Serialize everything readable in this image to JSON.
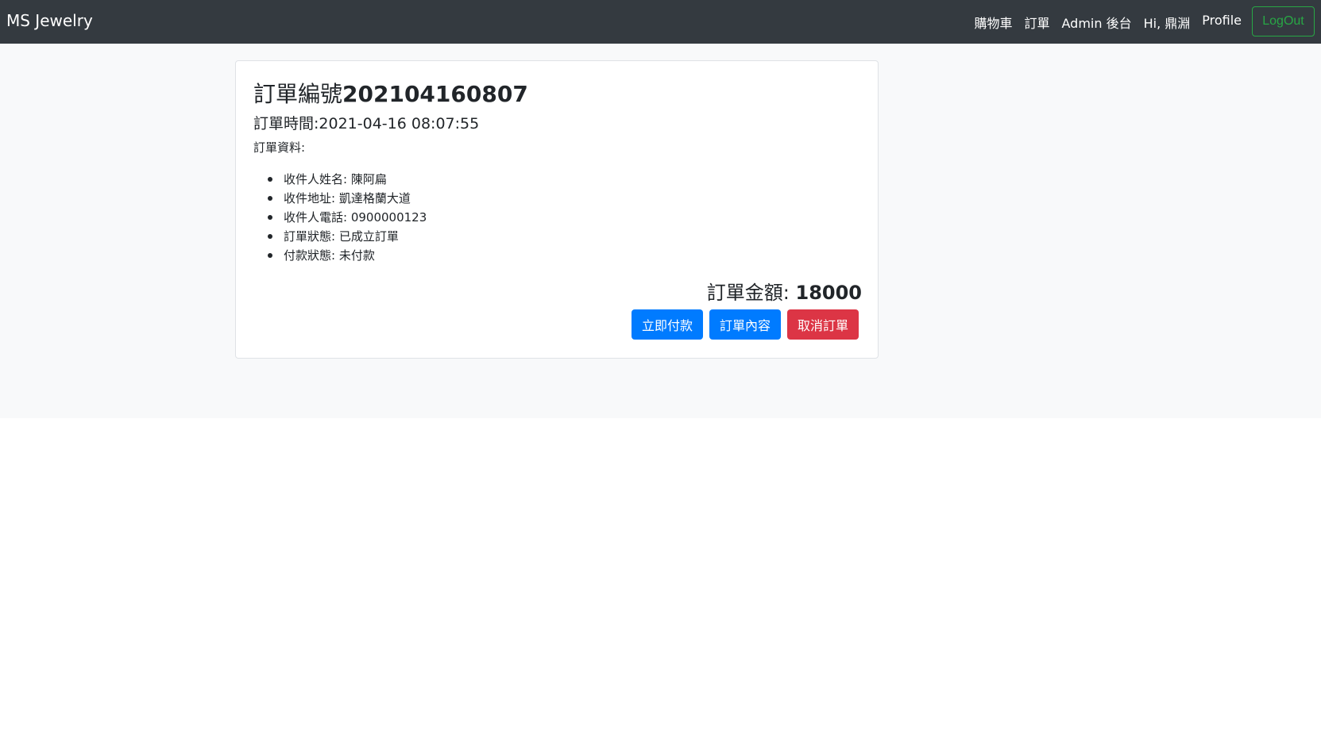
{
  "navbar": {
    "brand": "MS Jewelry",
    "links": [
      "購物車",
      "訂單",
      "Admin 後台",
      "Hi, 鼎淵",
      "Profile"
    ],
    "logout_label": "LogOut"
  },
  "order": {
    "number_label": "訂單編號",
    "number_value": "202104160807",
    "time_label": "訂單時間:",
    "time_value": "2021-04-16 08:07:55",
    "info_label": "訂單資料:",
    "info_items": [
      "收件人姓名: 陳阿扁",
      "收件地址: 凱達格蘭大道",
      "收件人電話: 0900000123",
      "訂單狀態: 已成立訂單",
      "付款狀態: 未付款"
    ],
    "total_label": "訂單金額: ",
    "total_value": "18000"
  },
  "actions": {
    "pay_label": "立即付款",
    "details_label": "訂單內容",
    "cancel_label": "取消訂單"
  },
  "colors": {
    "navbar_bg": "#343a40",
    "page_bg": "#f8f9fa",
    "primary": "#007bff",
    "danger": "#dc3545",
    "success": "#28a745"
  }
}
